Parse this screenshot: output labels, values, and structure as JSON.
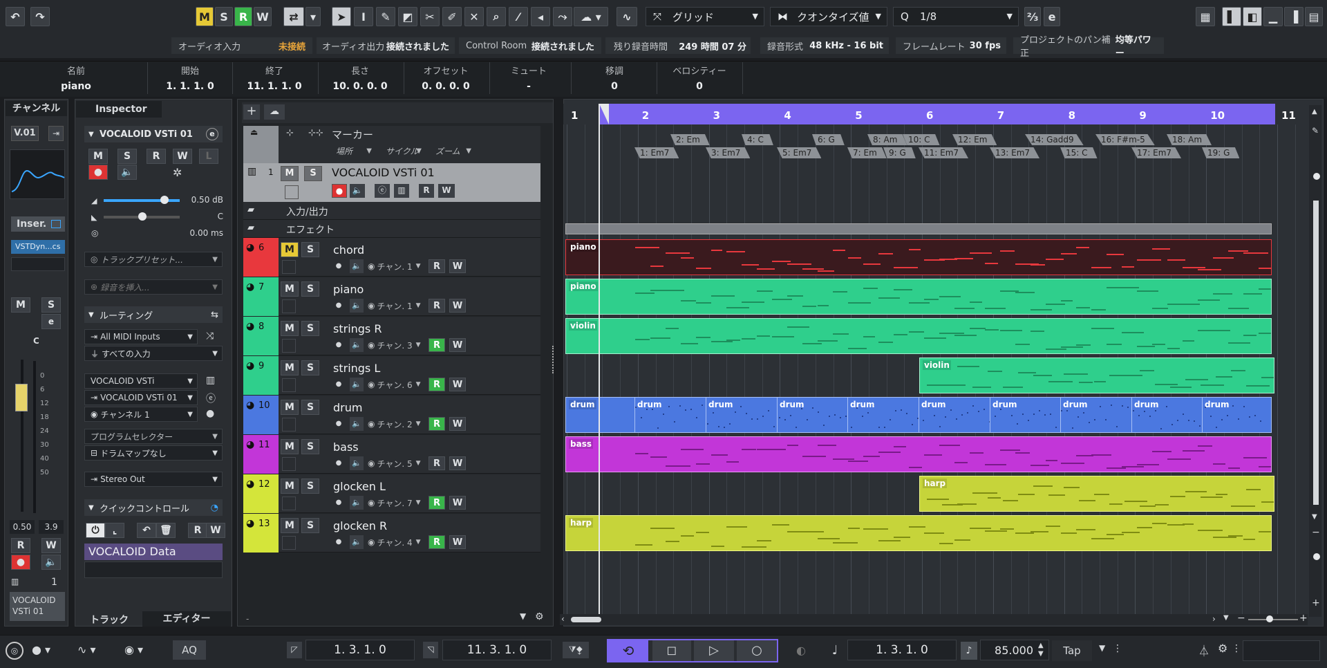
{
  "toolbar": {
    "ms_buttons": [
      "M",
      "S",
      "R",
      "W"
    ],
    "snap_type": "グリッド",
    "quantize_label": "クオンタイズ値",
    "quantize_value": "1/8"
  },
  "status_bar": [
    {
      "label": "オーディオ入力",
      "value": "未接続",
      "warn": true
    },
    {
      "label": "オーディオ出力",
      "value": "接続されました"
    },
    {
      "label": "Control Room",
      "value": "接続されました"
    },
    {
      "label": "残り録音時間",
      "value": "249 時間 07 分"
    },
    {
      "label": "録音形式",
      "value": "48 kHz - 16 bit"
    },
    {
      "label": "フレームレート",
      "value": "30 fps"
    },
    {
      "label": "プロジェクトのパン補正",
      "value": "均等パワー"
    }
  ],
  "info_line": [
    {
      "label": "名前",
      "value": "piano"
    },
    {
      "label": "開始",
      "value": "1. 1. 1.   0"
    },
    {
      "label": "終了",
      "value": "11. 1. 1.   0"
    },
    {
      "label": "長さ",
      "value": "10. 0. 0.   0"
    },
    {
      "label": "オフセット",
      "value": "0. 0. 0.   0"
    },
    {
      "label": "ミュート",
      "value": "-"
    },
    {
      "label": "移調",
      "value": "0"
    },
    {
      "label": "ベロシティー",
      "value": "0"
    }
  ],
  "channel_panel": {
    "tab": "チャンネル",
    "version": "V.01",
    "inserts": "Inser.",
    "insert_plugin": "VSTDyn...cs",
    "c_label": "C",
    "scale": [
      "0",
      "6",
      "12",
      "18",
      "24",
      "30",
      "40",
      "50"
    ],
    "readout_left": "0.50",
    "readout_right": "3.9",
    "midi_channel": "1",
    "name": "VOCALOID VSTi 01"
  },
  "inspector": {
    "tab": "Inspector",
    "instrument": "VOCALOID VSTi 01",
    "volume": "0.50 dB",
    "pan": "C",
    "delay": "0.00 ms",
    "track_preset": "トラックプリセット...",
    "record_insert": "録音を挿入...",
    "routing": "ルーティング",
    "midi_in": "All MIDI Inputs",
    "all_inputs": "すべての入力",
    "vsti": "VOCALOID VSTi",
    "vsti_out": "VOCALOID VSTi 01",
    "channel": "チャンネル 1",
    "program_selector": "プログラムセレクター",
    "drum_map": "ドラムマップなし",
    "output": "Stereo Out",
    "quick_controls": "クイックコントロール",
    "vocaloid_data": "VOCALOID Data",
    "bottom_tabs": [
      "トラック",
      "エディター"
    ]
  },
  "tracks": {
    "marker": {
      "name": "マーカー",
      "place": "場所",
      "cycle": "サイクル",
      "zoom": "ズーム"
    },
    "vocaloid": {
      "num": "1",
      "name": "VOCALOID VSTi 01"
    },
    "folders": [
      "入力/出力",
      "エフェクト"
    ],
    "list": [
      {
        "num": "6",
        "name": "chord",
        "color": "#e8383d",
        "chan": "チャン. 1",
        "muted": true,
        "r_on": false
      },
      {
        "num": "7",
        "name": "piano",
        "color": "#2fcf8c",
        "chan": "チャン. 1",
        "muted": false,
        "r_on": false
      },
      {
        "num": "8",
        "name": "strings R",
        "color": "#2fcf8c",
        "chan": "チャン. 3",
        "muted": false,
        "r_on": true
      },
      {
        "num": "9",
        "name": "strings L",
        "color": "#2fcf8c",
        "chan": "チャン. 6",
        "muted": false,
        "r_on": true
      },
      {
        "num": "10",
        "name": "drum",
        "color": "#4b78e0",
        "chan": "チャン. 2",
        "muted": false,
        "r_on": true
      },
      {
        "num": "11",
        "name": "bass",
        "color": "#c236d8",
        "chan": "チャン. 5",
        "muted": false,
        "r_on": false
      },
      {
        "num": "12",
        "name": "glocken L",
        "color": "#d4e53a",
        "chan": "チャン. 7",
        "muted": false,
        "r_on": true
      },
      {
        "num": "13",
        "name": "glocken R",
        "color": "#d4e53a",
        "chan": "チャン. 4",
        "muted": false,
        "r_on": true
      }
    ]
  },
  "ruler": [
    "1",
    "2",
    "3",
    "4",
    "5",
    "6",
    "7",
    "8",
    "9",
    "10",
    "11"
  ],
  "chords_top": [
    "2: Em",
    "4: C",
    "6: G",
    "8: Am",
    "10: C",
    "12: Em",
    "14: Gadd9",
    "16: F#m-5",
    "18: Am"
  ],
  "chords_bottom": [
    "1: Em7",
    "3: Em7",
    "5: Em7",
    "7: Em",
    "9: G",
    "11: Em7",
    "13: Em7",
    "15: C",
    "17: Em7",
    "19: G"
  ],
  "parts": {
    "chord": "piano",
    "piano": "piano",
    "stringsR": "violin",
    "stringsL": "violin",
    "drum": "drum",
    "bass": "bass",
    "glockenL": "harp",
    "glockenR": "harp"
  },
  "transport": {
    "left_locator": "1.  3.  1.    0",
    "right_locator": "11.  3.  1.    0",
    "position": "1.  3.  1.    0",
    "tempo": "85.000",
    "tap": "Tap",
    "aq": "AQ"
  }
}
